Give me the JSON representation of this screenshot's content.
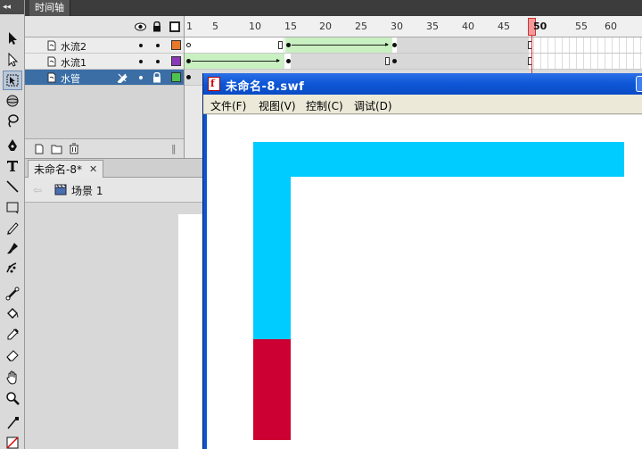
{
  "timeline": {
    "tab_label": "时间轴",
    "ruler_labels": [
      "1",
      "5",
      "10",
      "15",
      "20",
      "25",
      "30",
      "35",
      "40",
      "45",
      "50",
      "55",
      "60"
    ],
    "current_frame": "50",
    "layers": [
      {
        "name": "水流2",
        "color": "#e8782a"
      },
      {
        "name": "水流1",
        "color": "#8a3ab8"
      },
      {
        "name": "水管",
        "color": "#4ec24e"
      }
    ]
  },
  "document": {
    "tab_label": "未命名-8*",
    "close_glyph": "✕",
    "back_glyph": "⇦",
    "scene_label": "场景 1"
  },
  "swf_window": {
    "title": "未命名-8.swf",
    "menu": [
      "文件(F)",
      "视图(V)",
      "控制(C)",
      "调试(D)"
    ]
  },
  "colors": {
    "pipe": "#00ccff",
    "water": "#cc0033",
    "tween": "#c9f0c0"
  }
}
